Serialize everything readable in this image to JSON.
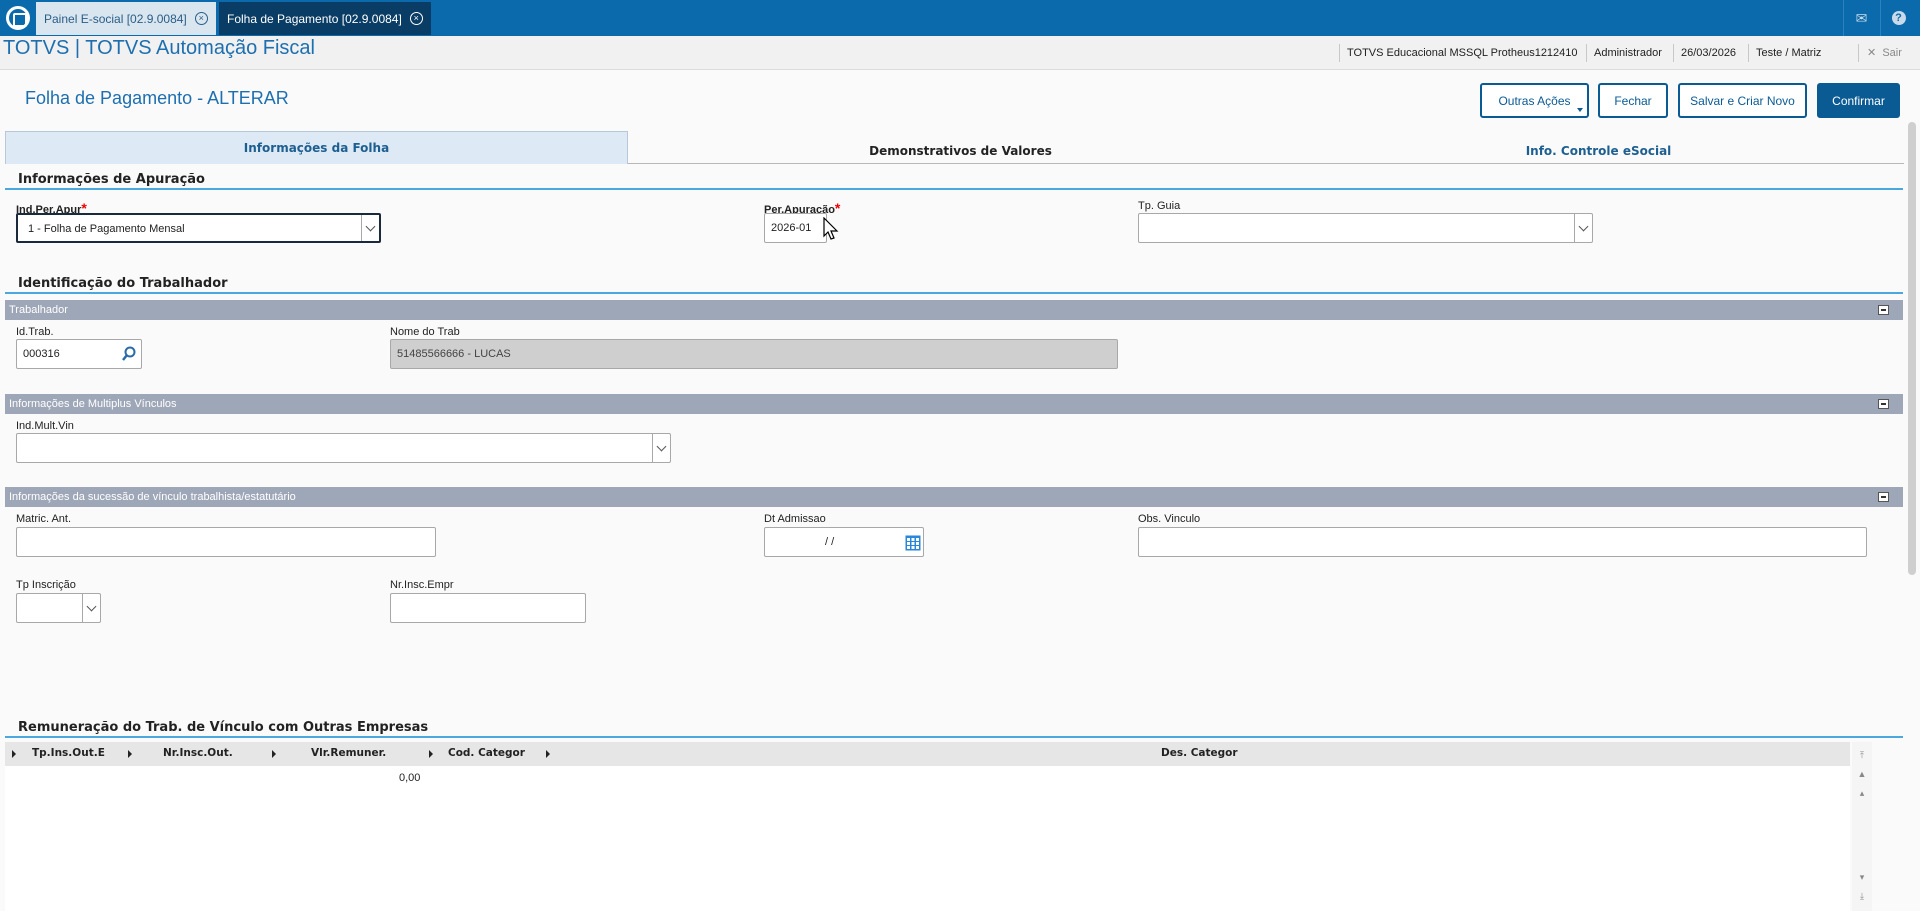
{
  "top_tabs": [
    {
      "label": "Painel E-social [02.9.0084]",
      "active": false
    },
    {
      "label": "Folha de Pagamento [02.9.0084]",
      "active": true
    }
  ],
  "app_title": "TOTVS | TOTVS Automação Fiscal",
  "session": {
    "environment": "TOTVS Educacional MSSQL Protheus1212410",
    "user": "Administrador",
    "date": "26/03/2026",
    "branch": "Teste / Matriz",
    "logout_label": "Sair"
  },
  "page_title": "Folha de Pagamento - ALTERAR",
  "actions": {
    "other": "Outras Ações",
    "close": "Fechar",
    "save_new": "Salvar e Criar Novo",
    "confirm": "Confirmar"
  },
  "form_tabs": [
    "Informações da Folha",
    "Demonstrativos de Valores",
    "Info. Controle eSocial"
  ],
  "apuracao": {
    "title": "Informações de Apuração",
    "ind_per_apur_label": "Ind.Per.Apur",
    "ind_per_apur_value": "1 - Folha de Pagamento Mensal",
    "per_apuracao_label": "Per.Apuração",
    "per_apuracao_value": "2026-01",
    "tp_guia_label": "Tp. Guia",
    "tp_guia_value": ""
  },
  "trabalhador": {
    "title": "Identificação do Trabalhador",
    "group_label": "Trabalhador",
    "id_trab_label": "Id.Trab.",
    "id_trab_value": "000316",
    "nome_label": "Nome do Trab",
    "nome_value": "51485566666 - LUCAS"
  },
  "multiplos": {
    "group_label": "Informações de Multiplus Vínculos",
    "ind_mult_label": "Ind.Mult.Vin",
    "ind_mult_value": ""
  },
  "sucessao": {
    "group_label": "Informações da sucessão de vínculo trabalhista/estatutário",
    "matric_label": "Matric. Ant.",
    "matric_value": "",
    "dt_admissao_label": "Dt Admissao",
    "dt_admissao_value": "/ /",
    "obs_label": "Obs. Vinculo",
    "obs_value": "",
    "tp_insc_label": "Tp Inscrição",
    "tp_insc_value": "",
    "nr_insc_label": "Nr.Insc.Empr",
    "nr_insc_value": ""
  },
  "remuneracao": {
    "title": "Remuneração do Trab. de Vínculo com Outras Empresas",
    "columns": [
      "Tp.Ins.Out.E",
      "Nr.Insc.Out.",
      "Vlr.Remuner.",
      "Cod. Categor",
      "Des. Categor"
    ],
    "rows": [
      [
        "",
        "",
        "0,00",
        "",
        ""
      ]
    ]
  }
}
